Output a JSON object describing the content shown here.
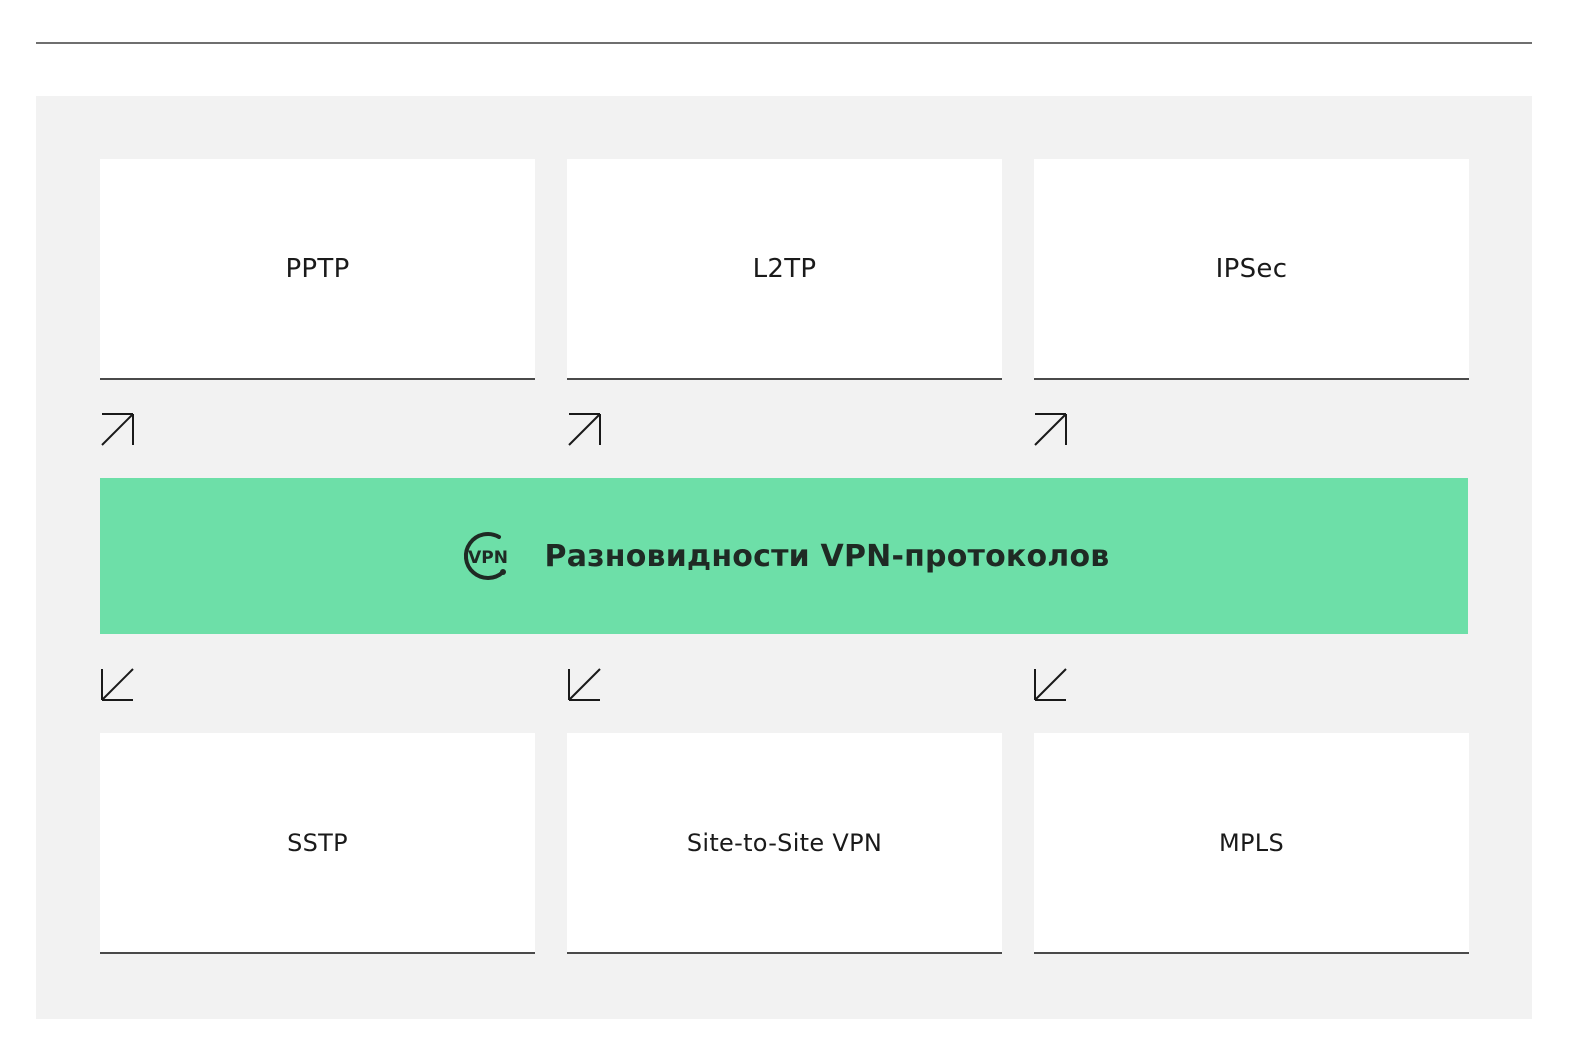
{
  "banner": {
    "title": "Разновидности VPN-протоколов",
    "icon": "vpn-icon",
    "icon_text": "VPN",
    "color": "#6ddfa8"
  },
  "protocols_top": [
    {
      "label": "PPTP"
    },
    {
      "label": "L2TP"
    },
    {
      "label": "IPSec"
    }
  ],
  "protocols_bottom": [
    {
      "label": "SSTP"
    },
    {
      "label": "Site-to-Site VPN"
    },
    {
      "label": "MPLS"
    }
  ],
  "arrows": {
    "top_icon": "arrow-up-right-icon",
    "bottom_icon": "arrow-down-left-icon"
  },
  "colors": {
    "panel_background": "#f2f2f2",
    "card_background": "#ffffff",
    "rule": "#4a4a4a"
  }
}
